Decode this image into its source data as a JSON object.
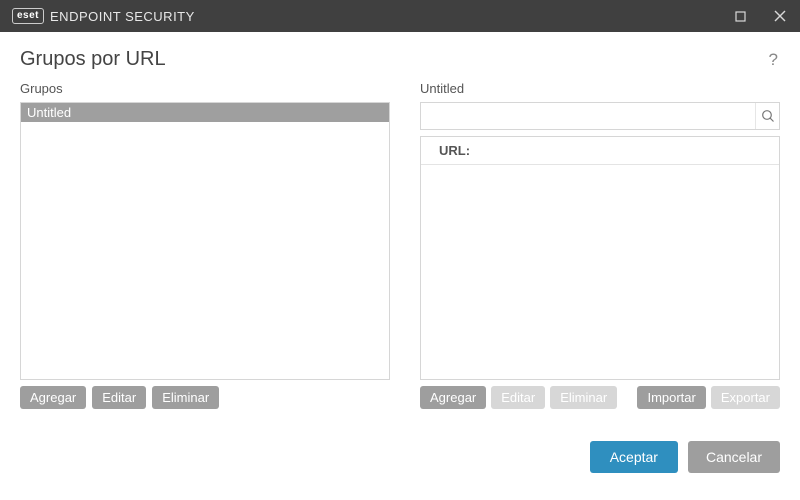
{
  "brand": {
    "badge": "eset",
    "product": "ENDPOINT SECURITY"
  },
  "page_title": "Grupos por URL",
  "labels": {
    "groups": "Grupos",
    "right_title": "Untitled",
    "url_col": "URL:"
  },
  "groups": {
    "items": [
      "Untitled"
    ]
  },
  "search": {
    "value": ""
  },
  "buttons": {
    "left": {
      "add": "Agregar",
      "edit": "Editar",
      "remove": "Eliminar"
    },
    "right": {
      "add": "Agregar",
      "edit": "Editar",
      "remove": "Eliminar",
      "import": "Importar",
      "export": "Exportar"
    }
  },
  "footer": {
    "accept": "Aceptar",
    "cancel": "Cancelar"
  }
}
